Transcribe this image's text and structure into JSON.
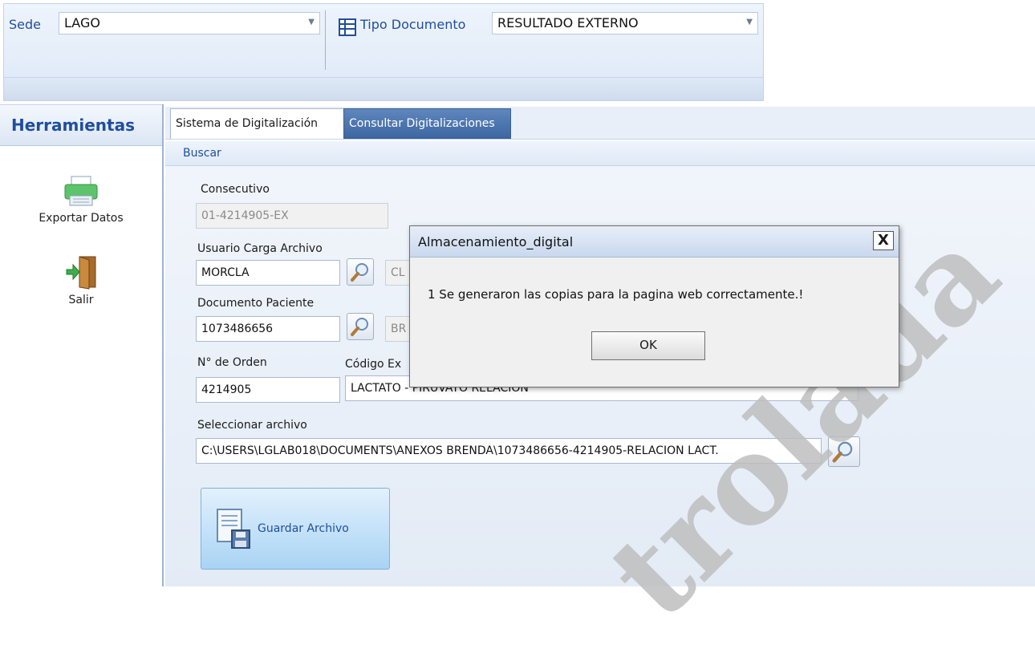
{
  "ribbon": {
    "sede_label": "Sede",
    "sede_value": "LAGO",
    "tipo_label": "Tipo Documento",
    "tipo_value": "RESULTADO EXTERNO"
  },
  "tools": {
    "title": "Herramientas",
    "export_label": "Exportar Datos",
    "exit_label": "Salir"
  },
  "tabs": [
    {
      "label": "Sistema de Digitalización"
    },
    {
      "label": "Consultar Digitalizaciones"
    }
  ],
  "subbar": {
    "buscar": "Buscar"
  },
  "form": {
    "consecutivo_label": "Consecutivo",
    "consecutivo_value": "01-4214905-EX",
    "usuario_label": "Usuario Carga Archivo",
    "usuario_value": "MORCLA",
    "usuario_name": "CL",
    "documento_label": "Documento Paciente",
    "documento_value": "1073486656",
    "documento_name": "BR",
    "orden_label": "N° de Orden",
    "orden_value": "4214905",
    "codigo_label": "Código Ex",
    "codigo_value": "LACTATO - PIRUVATO RELACION",
    "archivo_label": "Seleccionar archivo",
    "archivo_value": "C:\\USERS\\LGLAB018\\DOCUMENTS\\ANEXOS BRENDA\\1073486656-4214905-RELACION LACT.",
    "save_label": "Guardar Archivo"
  },
  "dialog": {
    "title": "Almacenamiento_digital",
    "message": "1 Se generaron las copias para la pagina web correctamente.!",
    "ok": "OK",
    "close": "X"
  },
  "watermark": "trolada",
  "colors": {
    "accent": "#1f4e9e",
    "tab_inactive": "#4a73ae",
    "watermark": "#bdbdbd"
  }
}
